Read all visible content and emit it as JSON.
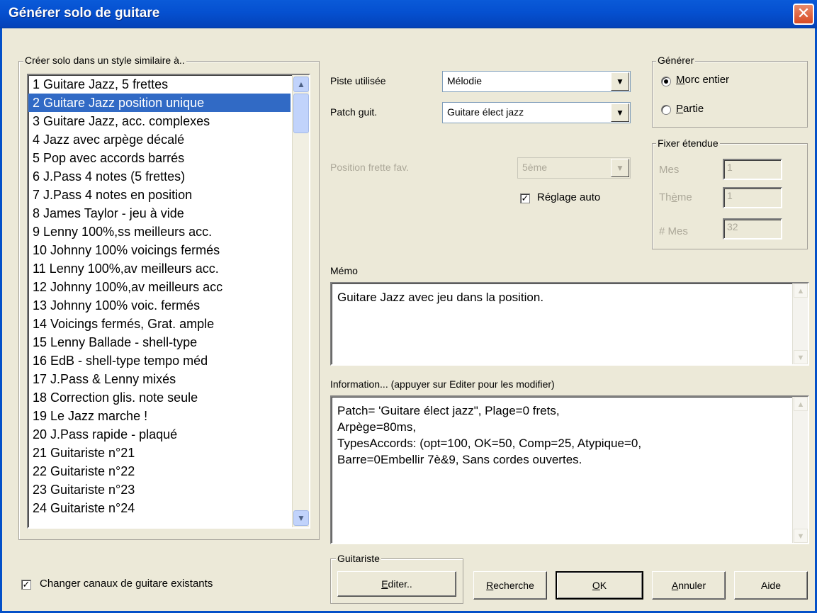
{
  "window": {
    "title": "Générer solo de guitare",
    "close_glyph": "✕"
  },
  "style_group": {
    "label": "Créer solo dans un style similaire à..",
    "items": [
      "1 Guitare Jazz, 5 frettes",
      "2 Guitare Jazz position unique",
      "3 Guitare Jazz, acc. complexes",
      "4 Jazz avec arpège décalé",
      "5 Pop avec accords barrés",
      "6 J.Pass 4 notes (5 frettes)",
      "7 J.Pass 4 notes en position",
      "8 James Taylor - jeu à vide",
      "9 Lenny 100%,ss meilleurs acc.",
      "10 Johnny 100% voicings fermés",
      "11 Lenny 100%,av meilleurs acc.",
      "12 Johnny 100%,av meilleurs acc",
      "13 Johnny 100% voic. fermés",
      "14 Voicings fermés, Grat. ample",
      "15 Lenny Ballade - shell-type",
      "16 EdB - shell-type tempo méd",
      "17 J.Pass & Lenny mixés",
      "18 Correction glis. note seule",
      "19 Le Jazz marche !",
      "20 J.Pass rapide - plaqué",
      "21 Guitariste n°21",
      "22 Guitariste n°22",
      "23 Guitariste n°23",
      "24 Guitariste n°24"
    ],
    "selected_index": 1
  },
  "track": {
    "label": "Piste utilisée",
    "value": "Mélodie"
  },
  "patch": {
    "label": "Patch guit.",
    "value": "Guitare élect jazz"
  },
  "fret_position": {
    "label": "Position frette fav.",
    "value": "5ème"
  },
  "auto_setting": {
    "label": "Réglage auto",
    "checked": true
  },
  "generate": {
    "label": "Générer",
    "options": [
      {
        "label": "Morc entier",
        "checked": true
      },
      {
        "label": "Partie",
        "checked": false
      }
    ]
  },
  "range": {
    "label": "Fixer étendue",
    "fields": [
      {
        "label": "Mes",
        "value": "1"
      },
      {
        "label": "Thème",
        "value": "1"
      },
      {
        "label": "# Mes",
        "value": "32"
      }
    ]
  },
  "memo": {
    "label": "Mémo",
    "text": "Guitare Jazz avec jeu dans la position."
  },
  "info": {
    "label": "Information... (appuyer sur Editer pour les modifier)",
    "lines": [
      "Patch= 'Guitare élect jazz\", Plage=0 frets,",
      "Arpège=80ms,",
      "TypesAccords: (opt=100, OK=50, Comp=25, Atypique=0,",
      "Barre=0Embellir 7è&9, Sans cordes ouvertes."
    ]
  },
  "change_channels": {
    "label": "Changer canaux de guitare existants",
    "checked": true
  },
  "guitarist_group": {
    "label": "Guitariste",
    "edit_button": "Editer.."
  },
  "buttons": {
    "search": "Recherche",
    "ok": "OK",
    "cancel": "Annuler",
    "help": "Aide"
  }
}
